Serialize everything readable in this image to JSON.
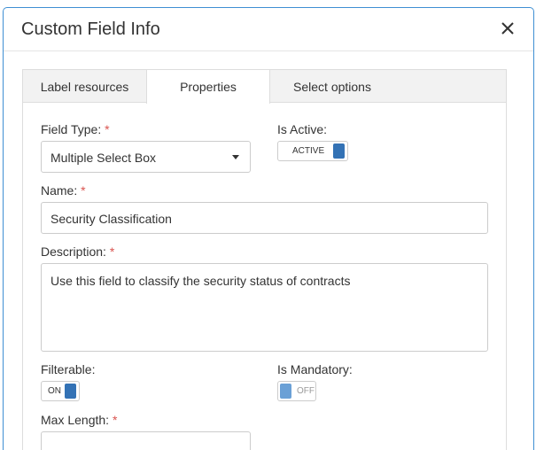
{
  "dialog": {
    "title": "Custom Field Info",
    "close_icon": "close-icon"
  },
  "tabs": [
    {
      "label": "Label resources",
      "active": false
    },
    {
      "label": "Properties",
      "active": true
    },
    {
      "label": "Select options",
      "active": false
    }
  ],
  "form": {
    "field_type": {
      "label": "Field Type:",
      "required_mark": "*",
      "value": "Multiple Select Box"
    },
    "is_active": {
      "label": "Is Active:",
      "toggle_text": "ACTIVE",
      "state": "on"
    },
    "name": {
      "label": "Name:",
      "required_mark": "*",
      "value": "Security Classification"
    },
    "description": {
      "label": "Description:",
      "required_mark": "*",
      "value": "Use this field to classify the security status of contracts"
    },
    "filterable": {
      "label": "Filterable:",
      "toggle_text": "ON",
      "state": "on"
    },
    "is_mandatory": {
      "label": "Is Mandatory:",
      "toggle_text": "OFF",
      "state": "off"
    },
    "max_length": {
      "label": "Max Length:",
      "required_mark": "*",
      "value": ""
    }
  },
  "colors": {
    "accent": "#3372b5",
    "required": "#d9534f",
    "dialog_border": "#3f8fd3"
  }
}
